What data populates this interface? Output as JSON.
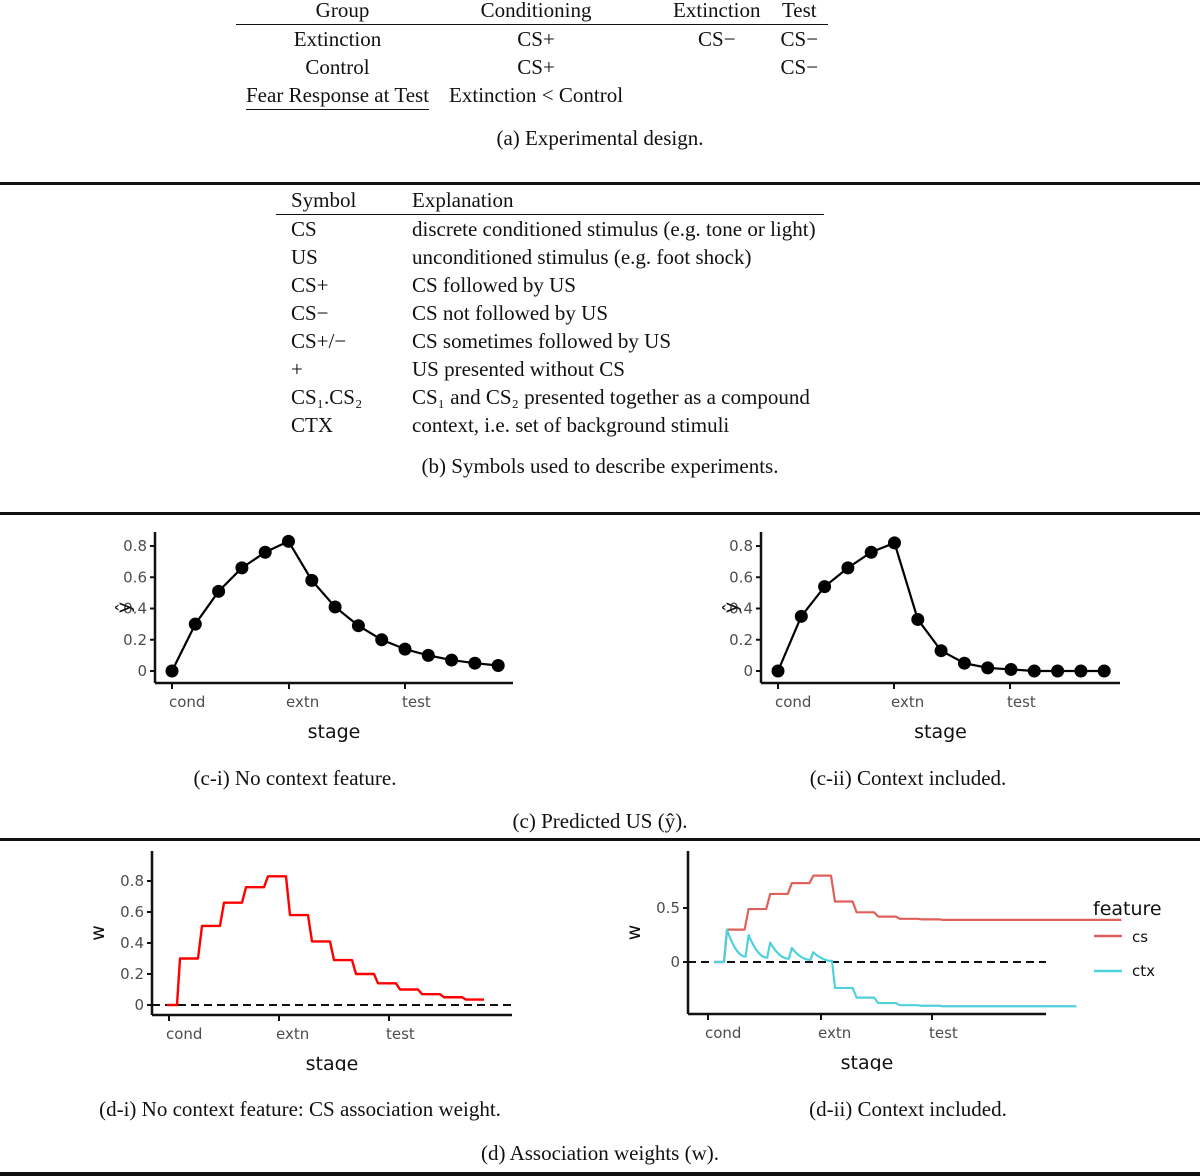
{
  "panel_a": {
    "headers": [
      "Group",
      "Conditioning",
      "Extinction",
      "Test"
    ],
    "rows": [
      [
        "Extinction",
        "CS+",
        "CS−",
        "CS−"
      ],
      [
        "Control",
        "CS+",
        "",
        "CS−"
      ]
    ],
    "result_label": "Fear Response at Test",
    "result_value": "Extinction < Control",
    "caption": "(a) Experimental design."
  },
  "panel_b": {
    "headers": [
      "Symbol",
      "Explanation"
    ],
    "rows": [
      {
        "symbol": "CS",
        "explanation": "discrete conditioned stimulus (e.g. tone or light)"
      },
      {
        "symbol": "US",
        "explanation": "unconditioned stimulus (e.g. foot shock)"
      },
      {
        "symbol": "CS+",
        "explanation": "CS followed by US"
      },
      {
        "symbol": "CS−",
        "explanation": "CS not followed by US"
      },
      {
        "symbol": "CS+/−",
        "explanation": "CS sometimes followed by US"
      },
      {
        "symbol": "+",
        "explanation": "US presented without CS"
      },
      {
        "symbol": "CS₁.CS₂",
        "explanation": "CS₁ and CS₂ presented together as a compound"
      },
      {
        "symbol": "CTX",
        "explanation": "context, i.e. set of background stimuli"
      }
    ],
    "caption": "(b) Symbols used to describe experiments."
  },
  "panel_c": {
    "caption": "(c) Predicted US (ŷ).",
    "sub_i_caption": "(c-i) No context feature.",
    "sub_ii_caption": "(c-ii) Context included."
  },
  "panel_d": {
    "caption": "(d) Association weights (w).",
    "sub_i_caption": "(d-i) No context feature: CS association weight.",
    "sub_ii_caption": "(d-ii) Context included."
  },
  "chart_data": [
    {
      "id": "c-i",
      "type": "line",
      "markers": true,
      "title": "",
      "xlabel": "stage",
      "ylabel": "ŷ",
      "xticks": [
        "cond",
        "extn",
        "test"
      ],
      "yticks": [
        "0",
        "0.2",
        "0.4",
        "0.6",
        "0.8"
      ],
      "ylim": [
        0,
        0.83
      ],
      "trial_index": [
        0,
        1,
        2,
        3,
        4,
        5,
        6,
        7,
        8,
        9,
        10,
        11,
        12,
        13,
        14
      ],
      "series": [
        {
          "name": "y_hat",
          "color": "#000000",
          "values": [
            0.0,
            0.3,
            0.51,
            0.66,
            0.76,
            0.83,
            0.58,
            0.41,
            0.29,
            0.2,
            0.14,
            0.1,
            0.07,
            0.05,
            0.035
          ]
        }
      ]
    },
    {
      "id": "c-ii",
      "type": "line",
      "markers": true,
      "title": "",
      "xlabel": "stage",
      "ylabel": "ŷ",
      "xticks": [
        "cond",
        "extn",
        "test"
      ],
      "yticks": [
        "0",
        "0.2",
        "0.4",
        "0.6",
        "0.8"
      ],
      "ylim": [
        0,
        0.83
      ],
      "trial_index": [
        0,
        1,
        2,
        3,
        4,
        5,
        6,
        7,
        8,
        9,
        10,
        11,
        12,
        13,
        14
      ],
      "series": [
        {
          "name": "y_hat",
          "color": "#000000",
          "values": [
            0.0,
            0.35,
            0.54,
            0.66,
            0.76,
            0.82,
            0.33,
            0.13,
            0.05,
            0.02,
            0.01,
            0.0,
            0.0,
            0.0,
            0.0
          ]
        }
      ]
    },
    {
      "id": "d-i",
      "type": "line",
      "step": true,
      "title": "",
      "xlabel": "stage",
      "ylabel": "w",
      "xticks": [
        "cond",
        "extn",
        "test"
      ],
      "yticks": [
        "0",
        "0.2",
        "0.4",
        "0.6",
        "0.8"
      ],
      "ylim": [
        -0.03,
        0.83
      ],
      "reference_line": {
        "y": 0,
        "style": "dashed"
      },
      "series": [
        {
          "name": "cs",
          "color": "#ff0000",
          "values": [
            0.0,
            0.3,
            0.51,
            0.66,
            0.76,
            0.83,
            0.58,
            0.41,
            0.29,
            0.2,
            0.14,
            0.1,
            0.07,
            0.05,
            0.035
          ]
        }
      ]
    },
    {
      "id": "d-ii",
      "type": "line",
      "title": "",
      "xlabel": "stage",
      "ylabel": "w",
      "xticks": [
        "cond",
        "extn",
        "test"
      ],
      "yticks": [
        "0",
        "0.5"
      ],
      "ylim": [
        -0.45,
        0.8
      ],
      "reference_line": {
        "y": 0,
        "style": "dashed"
      },
      "legend": {
        "title": "feature",
        "position": "right"
      },
      "series": [
        {
          "name": "cs",
          "color": "#e0605a",
          "values": [
            0.0,
            0.3,
            0.49,
            0.63,
            0.73,
            0.8,
            0.56,
            0.46,
            0.42,
            0.4,
            0.395,
            0.39,
            0.39,
            0.39,
            0.39
          ]
        },
        {
          "name": "ctx",
          "color": "#4fd1dc",
          "peaks": [
            0.3,
            0.25,
            0.18,
            0.13,
            0.09
          ],
          "troughs": [
            0.05,
            0.04,
            0.03,
            0.02,
            0.01
          ],
          "values_extinction_test": [
            -0.24,
            -0.33,
            -0.38,
            -0.4,
            -0.405,
            -0.41,
            -0.41,
            -0.41,
            -0.41
          ]
        }
      ]
    }
  ]
}
